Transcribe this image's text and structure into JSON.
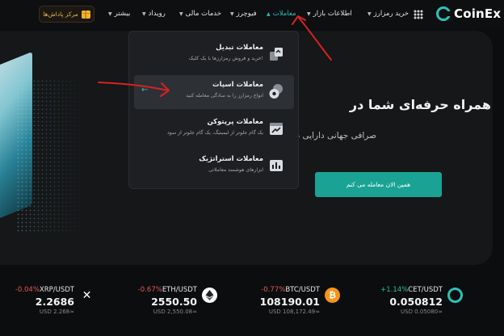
{
  "brand": {
    "name": "CoinEx"
  },
  "nav": {
    "items": [
      {
        "label": "خرید رمزارز",
        "active": false
      },
      {
        "label": "اطلاعات بازار",
        "active": false
      },
      {
        "label": "معاملات",
        "active": true
      },
      {
        "label": "فیوچرز",
        "active": false
      },
      {
        "label": "خدمات مالی",
        "active": false
      },
      {
        "label": "رویداد",
        "active": false
      },
      {
        "label": "بیشتر",
        "active": false
      }
    ],
    "rewards_label": "مرکز پاداش‌ها"
  },
  "hero": {
    "title": "همراه حرفه‌ای شما در",
    "subtitle": "صرافی جهانی دارایی دیجیتال",
    "cta_label": "همین الان معامله می کنم"
  },
  "dropdown": {
    "items": [
      {
        "title": "معاملات تبدیل",
        "desc": "خرید و فروش رمزارزها با یک کلیک!",
        "icon": "convert-icon",
        "highlighted": false
      },
      {
        "title": "معاملات اسپات",
        "desc": "انواع رمزارز را به سادگی معامله کنید",
        "icon": "spot-icon",
        "highlighted": true
      },
      {
        "title": "معاملات پرپتوکن",
        "desc": "یک گام جلوتر از لیمیتیگ، یک گام جلوتر از سود",
        "icon": "perpetual-icon",
        "highlighted": false
      },
      {
        "title": "معاملات استراتژیک",
        "desc": "ابزارهای هوشمند معاملاتی",
        "icon": "strategy-icon",
        "highlighted": false
      }
    ]
  },
  "ticker": [
    {
      "pair": "CET/USDT",
      "change": "+1.14%",
      "direction": "up",
      "price": "0.050812",
      "usd": "USD 0.05080≈",
      "icon": "coinex-coin-icon",
      "color": "#2bc2b4"
    },
    {
      "pair": "BTC/USDT",
      "change": "-0.77%",
      "direction": "down",
      "price": "108190.01",
      "usd": "USD 108,172.49≈",
      "icon": "bitcoin-icon",
      "color": "#f7931a"
    },
    {
      "pair": "ETH/USDT",
      "change": "-0.67%",
      "direction": "down",
      "price": "2550.50",
      "usd": "USD 2,550.08≈",
      "icon": "ethereum-icon",
      "color": "#ffffff"
    },
    {
      "pair": "XRP/USDT",
      "change": "-0.04%",
      "direction": "down",
      "price": "2.2686",
      "usd": "USD 2.268≈",
      "icon": "xrp-icon",
      "color": "#ffffff"
    }
  ],
  "colors": {
    "accent": "#2bc2b4",
    "cta": "#1aa394",
    "up": "#29c48a",
    "down": "#e05858",
    "annotation": "#d62222"
  }
}
